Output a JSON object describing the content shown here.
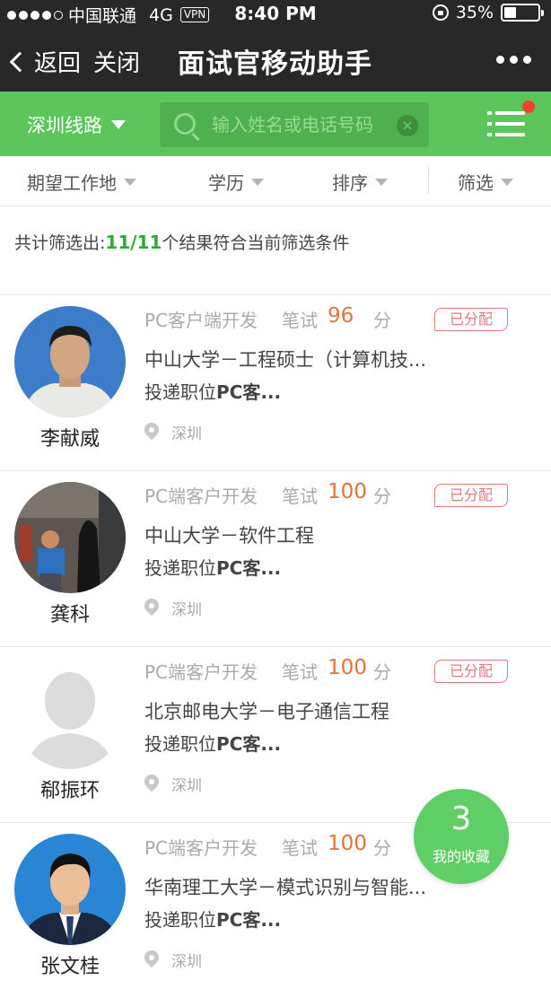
{
  "status_bar": {
    "carrier": "中国联通",
    "network": "4G",
    "vpn": "VPN",
    "time": "8:40 PM",
    "battery": "35%",
    "battery_level": 0.35
  },
  "nav": {
    "back_label": "返回",
    "close_label": "关闭",
    "title": "面试官移动助手"
  },
  "toolbar": {
    "route_label": "深圳线路",
    "search_placeholder": "输入姓名或电话号码"
  },
  "filters": [
    "期望工作地",
    "学历",
    "排序",
    "筛选"
  ],
  "summary": {
    "prefix": "共计筛选出:",
    "count": "11/11",
    "suffix": "个结果符合当前筛选条件"
  },
  "candidates": [
    {
      "name": "李献威",
      "position": "PC客户端开发",
      "exam_label": "笔试",
      "score": "96",
      "unit": "分",
      "status": "已分配",
      "school": "中山大学－工程硕士（计算机技...",
      "applied_prefix": "投递职位",
      "applied_job": "PC客...",
      "location": "深圳",
      "avatar": "photo-man-blue-background"
    },
    {
      "name": "龚科",
      "position": "PC端客户开发",
      "exam_label": "笔试",
      "score": "100",
      "unit": "分",
      "status": "已分配",
      "school": "中山大学－软件工程",
      "applied_prefix": "投递职位",
      "applied_job": "PC客...",
      "location": "深圳",
      "avatar": "photo-man-with-sculpture"
    },
    {
      "name": "郗振环",
      "position": "PC端客户开发",
      "exam_label": "笔试",
      "score": "100",
      "unit": "分",
      "status": "已分配",
      "school": "北京邮电大学－电子通信工程",
      "applied_prefix": "投递职位",
      "applied_job": "PC客...",
      "location": "深圳",
      "avatar": "default-user-placeholder"
    },
    {
      "name": "张文桂",
      "position": "PC端客户开发",
      "exam_label": "笔试",
      "score": "100",
      "unit": "分",
      "status": "",
      "school": "华南理工大学－模式识别与智能...",
      "applied_prefix": "投递职位",
      "applied_job": "PC客...",
      "location": "深圳",
      "avatar": "photo-man-suit-blue-background"
    }
  ],
  "favorite": {
    "count": "3",
    "label": "我的收藏"
  },
  "colors": {
    "topbar": "#282828",
    "accent_green": "#5cc65c",
    "score_orange": "#e27339",
    "badge_red": "#f0442f"
  }
}
